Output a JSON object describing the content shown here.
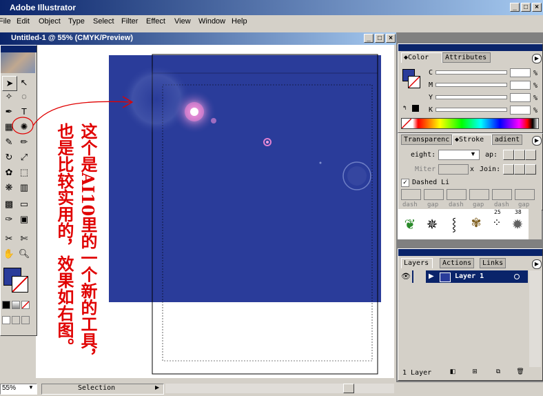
{
  "app": {
    "title": "Adobe Illustrator"
  },
  "menu": [
    "File",
    "Edit",
    "Object",
    "Type",
    "Select",
    "Filter",
    "Effect",
    "View",
    "Window",
    "Help"
  ],
  "document": {
    "title": "Untitled-1 @ 55% (CMYK/Preview)"
  },
  "color_panel": {
    "tabs": [
      "Color",
      "Attributes"
    ],
    "channels": [
      {
        "label": "C",
        "unit": "%"
      },
      {
        "label": "M",
        "unit": "%"
      },
      {
        "label": "Y",
        "unit": "%"
      },
      {
        "label": "K",
        "unit": "%"
      }
    ]
  },
  "stroke_panel": {
    "tabs": [
      "Transparenc",
      "Stroke",
      "adient"
    ],
    "weight_label": "eight:",
    "cap_label": "ap:",
    "miter_label": "Miter",
    "miter_suffix": "x",
    "join_label": "Join:",
    "dashed_label": "Dashed Li",
    "dash_labels": [
      "dash",
      "gap",
      "dash",
      "gap",
      "dash",
      "gap"
    ]
  },
  "brushes_panel": {
    "sizes": [
      "25",
      "38"
    ]
  },
  "layers_panel": {
    "tabs": [
      "Layers",
      "Actions",
      "Links"
    ],
    "layer_name": "Layer 1",
    "footer": "1 Layer"
  },
  "status": {
    "zoom": "55%",
    "mode": "Selection"
  },
  "annotation": {
    "line1": "这个是AI10里的一个新的工具，",
    "line2": "也是比较实用的，效果如右图。"
  },
  "colors": {
    "artboard_fill": "#2a3c9a",
    "accent_red": "#e00000",
    "title_bar": "#0a246a"
  }
}
